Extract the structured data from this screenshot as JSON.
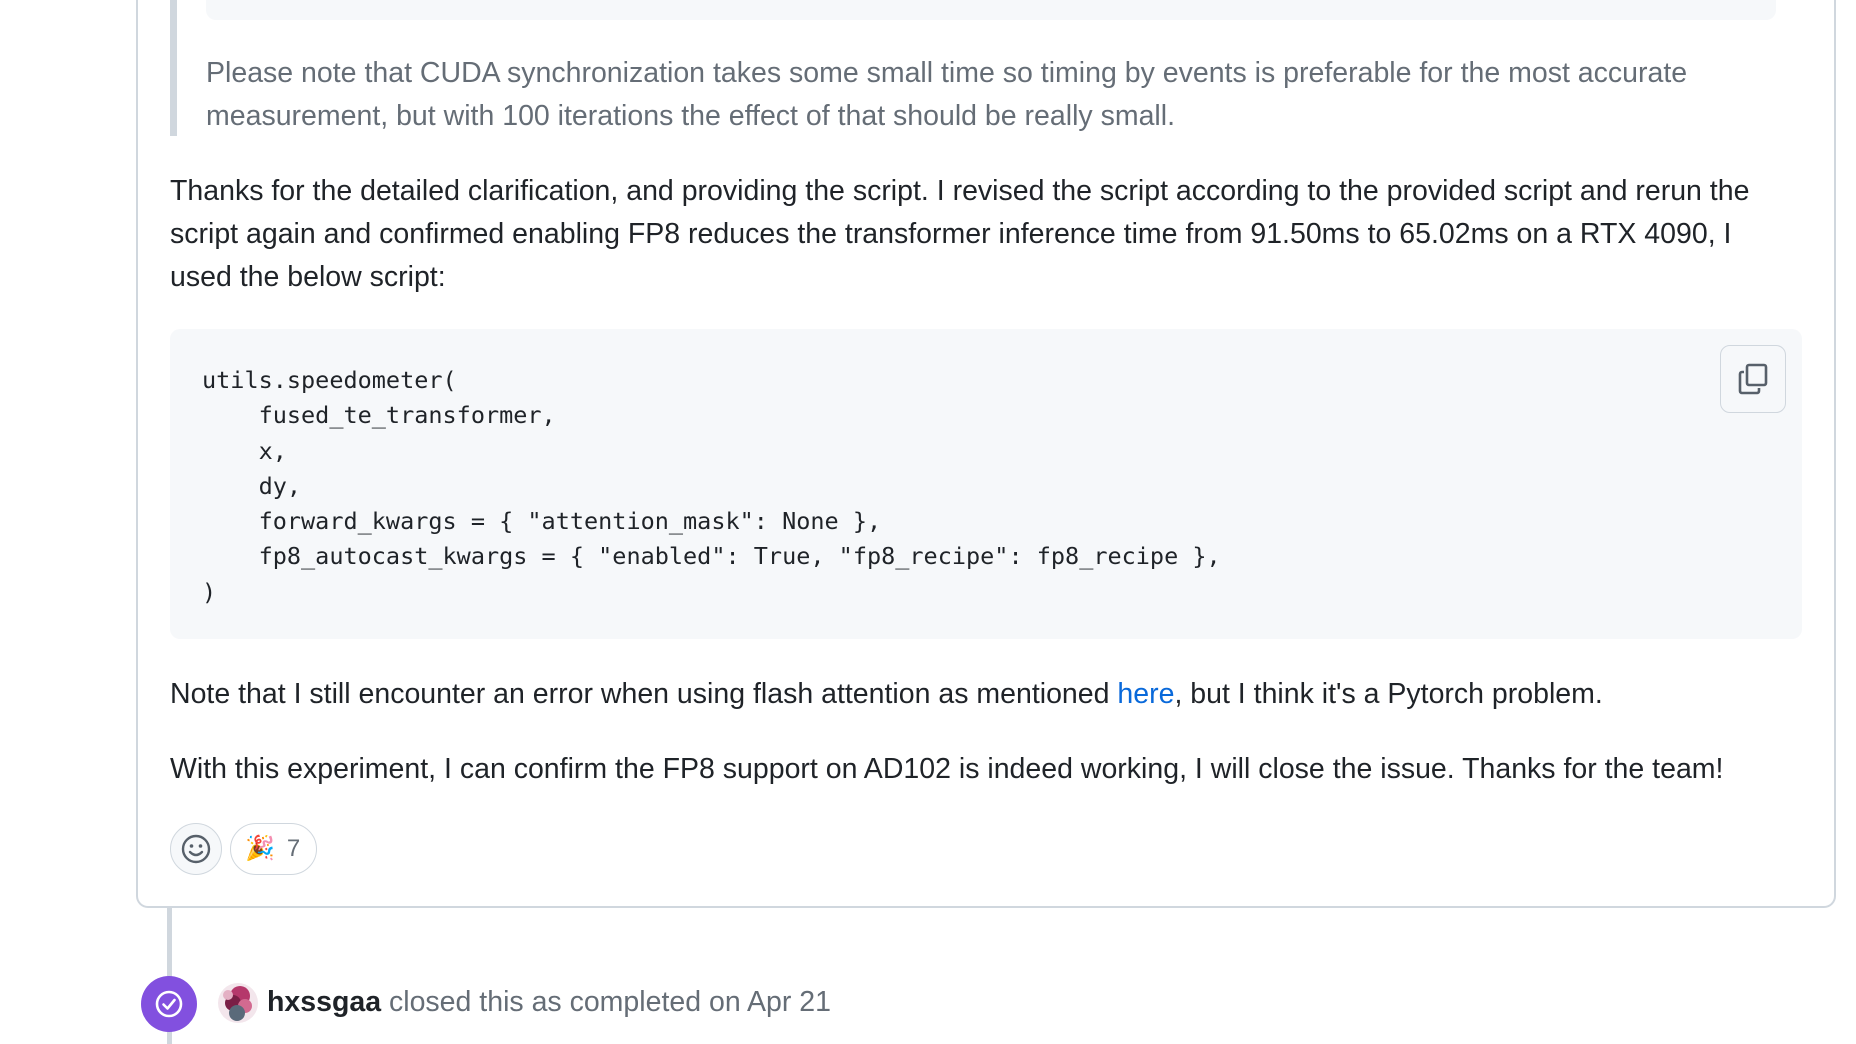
{
  "quote": {
    "text": "Please note that CUDA synchronization takes some small time so timing by events is preferable for the most accurate measurement, but with 100 iterations the effect of that should be really small."
  },
  "comment": {
    "paragraph1": "Thanks for the detailed clarification, and providing the script. I revised the script according to the provided script and rerun the script again and confirmed enabling FP8 reduces the transformer inference time from 91.50ms to 65.02ms on a RTX 4090, I used the below script:",
    "code": "utils.speedometer(\n    fused_te_transformer,\n    x,\n    dy,\n    forward_kwargs = { \"attention_mask\": None },\n    fp8_autocast_kwargs = { \"enabled\": True, \"fp8_recipe\": fp8_recipe },\n)",
    "paragraph2_before": "Note that I still encounter an error when using flash attention as mentioned ",
    "paragraph2_link": "here",
    "paragraph2_after": ", but I think it's a Pytorch problem.",
    "paragraph3": "With this experiment, I can confirm the FP8 support on AD102 is indeed working, I will close the issue. Thanks for the team!"
  },
  "reactions": {
    "add_icon": "smiley-icon",
    "items": [
      {
        "emoji": "🎉",
        "icon": "tada-icon",
        "count": "7"
      }
    ]
  },
  "code_block": {
    "copy_icon": "copy-icon"
  },
  "timeline_event": {
    "icon": "check-circle-icon",
    "badge_color": "#8250df",
    "username": "hxssgaa",
    "action": " closed this as completed on Apr 21"
  },
  "colors": {
    "link": "#0969da",
    "muted": "#656d76",
    "border": "#d0d7de"
  }
}
